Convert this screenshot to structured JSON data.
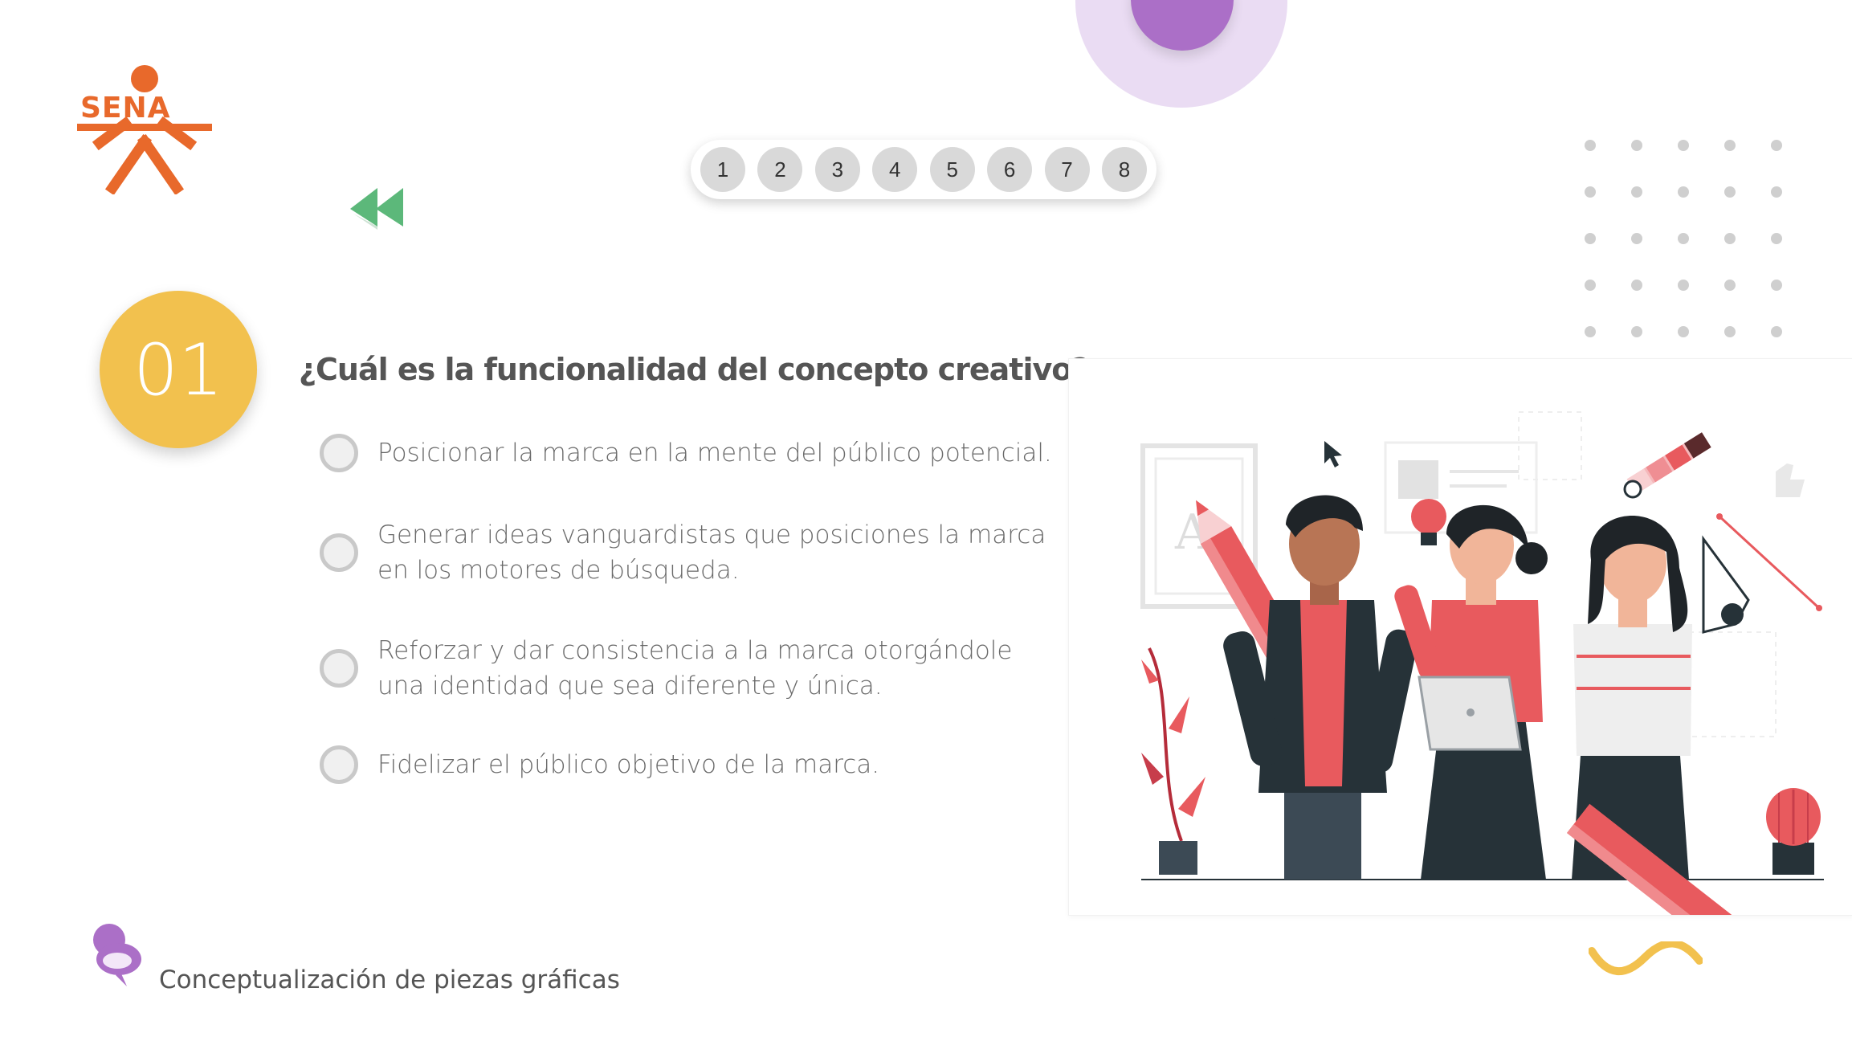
{
  "logo": {
    "text": "SENA"
  },
  "navigation": {
    "back_icon": "rewind-double-arrow",
    "pages": [
      "1",
      "2",
      "3",
      "4",
      "5",
      "6",
      "7",
      "8"
    ]
  },
  "quiz": {
    "number": "01",
    "question": "¿Cuál es la funcionalidad del concepto creativo?",
    "options": [
      "Posicionar la marca en la mente del público potencial.",
      "Generar ideas vanguardistas que posiciones la marca en los motores de búsqueda.",
      "Reforzar y dar consistencia a la marca otorgándole una identidad que sea diferente y única.",
      "Fidelizar el público objetivo de la marca."
    ]
  },
  "illustration": {
    "icon": "creative-team-illustration"
  },
  "footer": {
    "title": "Conceptualización de piezas gráficas",
    "icon": "push-pin-icon"
  },
  "colors": {
    "accent_orange": "#e8692b",
    "badge_yellow": "#f2c14e",
    "accent_purple": "#ab6fc7",
    "back_green": "#5cb87a",
    "illustration_red": "#e85a5e"
  }
}
